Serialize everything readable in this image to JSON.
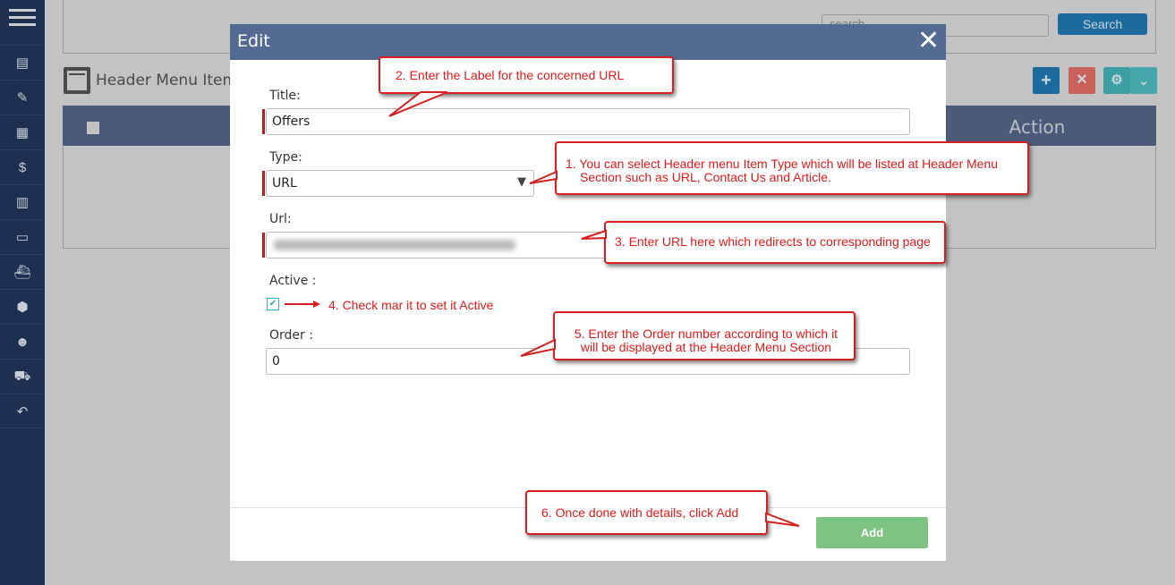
{
  "sidebar": {
    "items": [
      {
        "icon": "id-card-icon"
      },
      {
        "icon": "edit-list-icon"
      },
      {
        "icon": "layout-icon"
      },
      {
        "icon": "money-bag-icon"
      },
      {
        "icon": "book-icon"
      },
      {
        "icon": "ticket-icon"
      },
      {
        "icon": "ship-icon"
      },
      {
        "icon": "box-icon"
      },
      {
        "icon": "users-icon"
      },
      {
        "icon": "cart-icon"
      },
      {
        "icon": "undo-icon"
      }
    ]
  },
  "top": {
    "search_placeholder": "search",
    "search_label": "Search"
  },
  "section": {
    "title": "Header Menu Items",
    "action_header": "Action"
  },
  "toolbar": {
    "add": "+",
    "delete": "✕",
    "settings": "⚙",
    "dropdown": "⌄"
  },
  "modal": {
    "title": "Edit",
    "close": "✕",
    "title_label": "Title:",
    "title_value": "Offers",
    "type_label": "Type:",
    "type_value": "URL",
    "url_label": "Url:",
    "active_label": "Active :",
    "active_checked": true,
    "order_label": "Order :",
    "order_value": "0",
    "add_label": "Add"
  },
  "callouts": {
    "c1": "1. You can select Header menu Item Type which will be listed at Header Menu Section such as URL, Contact Us and Article.",
    "c2": "2. Enter the Label for the concerned URL",
    "c3": "3. Enter URL here which redirects to corresponding page",
    "c4": "4. Check mar it to set it Active",
    "c5": "5.  Enter the Order number according to which it will be displayed at the Header Menu Section",
    "c6": "6.  Once done with details, click Add"
  },
  "colors": {
    "sidebar": "#1d3052",
    "modal_header": "#536a93",
    "callout": "#d42020",
    "add": "#7cc47f"
  }
}
